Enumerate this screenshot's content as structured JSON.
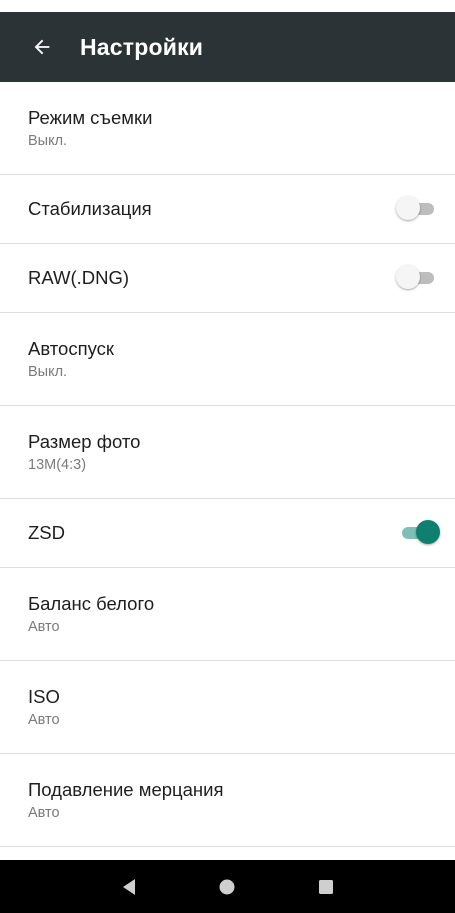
{
  "header": {
    "title": "Настройки",
    "back_icon": "arrow-back-icon"
  },
  "colors": {
    "appbar": "#2c3337",
    "accent": "#0f7f6f",
    "toggle_off_track": "#bdbdbd"
  },
  "settings": [
    {
      "title": "Режим съемки",
      "subtitle": "Выкл."
    },
    {
      "title": "Стабилизация",
      "toggle": false
    },
    {
      "title": "RAW(.DNG)",
      "toggle": false
    },
    {
      "title": "Автоспуск",
      "subtitle": "Выкл."
    },
    {
      "title": "Размер фото",
      "subtitle": "13M(4:3)"
    },
    {
      "title": "ZSD",
      "toggle": true
    },
    {
      "title": "Баланс белого",
      "subtitle": "Авто"
    },
    {
      "title": "ISO",
      "subtitle": "Авто"
    },
    {
      "title": "Подавление мерцания",
      "subtitle": "Авто"
    }
  ],
  "navbar": {
    "icons": [
      "nav-back-icon",
      "nav-home-icon",
      "nav-recents-icon"
    ]
  }
}
